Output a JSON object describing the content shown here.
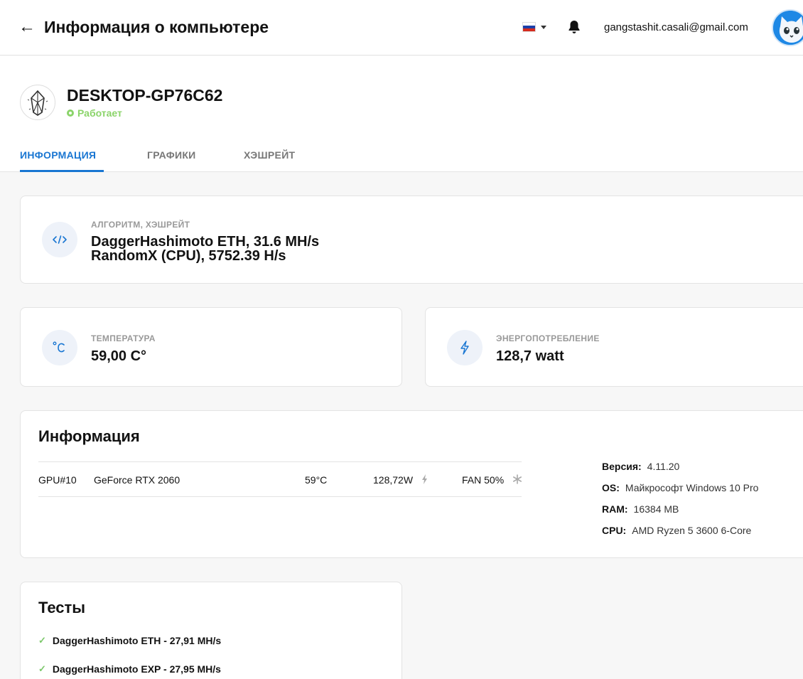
{
  "topbar": {
    "back_icon": "back-arrow-icon",
    "back_glyph": "←",
    "title": "Информация о компьютере",
    "language_flag": "russia-flag-icon",
    "notification_icon": "bell-icon",
    "user_email": "gangstashit.casali@gmail.com"
  },
  "device": {
    "name": "DESKTOP-GP76C62",
    "status": "Работает",
    "status_color": "#8bd46a"
  },
  "tabs": [
    {
      "label": "ИНФОРМАЦИЯ",
      "active": true
    },
    {
      "label": "ГРАФИКИ",
      "active": false
    },
    {
      "label": "ХЭШРЕЙТ",
      "active": false
    }
  ],
  "algorithm_card": {
    "icon": "code-icon",
    "label": "АЛГОРИТМ, ХЭШРЕЙТ",
    "lines": [
      "DaggerHashimoto ETH, 31.6 MH/s",
      "RandomX (CPU), 5752.39 H/s"
    ]
  },
  "temperature_card": {
    "icon": "celsius-icon",
    "label": "ТЕМПЕРАТУРА",
    "value": "59,00 C°"
  },
  "power_card": {
    "icon": "lightning-icon",
    "label": "ЭНЕРГОПОТРЕБЛЕНИЕ",
    "value": "128,7 watt"
  },
  "info_section": {
    "title": "Информация",
    "gpus": [
      {
        "id": "GPU#10",
        "model": "GeForce RTX 2060",
        "temp": "59°C",
        "power": "128,72W",
        "fan": "FAN 50%"
      }
    ],
    "specs": [
      {
        "key": "Версия:",
        "value": "4.11.20"
      },
      {
        "key": "OS:",
        "value": "Майкрософт Windows 10 Pro"
      },
      {
        "key": "RAM:",
        "value": "16384 MB"
      },
      {
        "key": "CPU:",
        "value": "AMD Ryzen 5 3600 6-Core"
      }
    ]
  },
  "tests_section": {
    "title": "Тесты",
    "items": [
      {
        "label": "DaggerHashimoto ETH - 27,91 MH/s",
        "icon": "check-icon"
      },
      {
        "label": "DaggerHashimoto EXP - 27,95 MH/s",
        "icon": "check-icon"
      }
    ]
  },
  "colors": {
    "accent": "#1976d2",
    "status_ok": "#8bd46a",
    "check": "#7cc86b"
  }
}
